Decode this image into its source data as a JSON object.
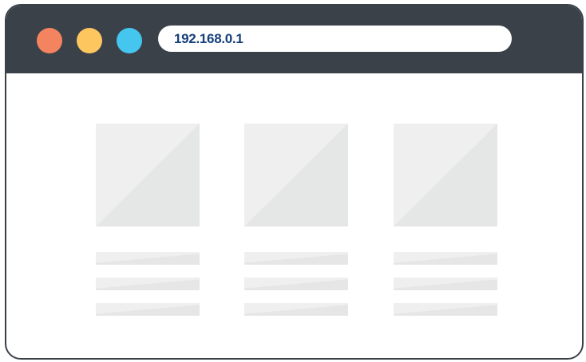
{
  "window": {
    "controls": {
      "close_color": "#f4845f",
      "minimize_color": "#fdc65f",
      "maximize_color": "#45c6ef"
    },
    "address_bar": {
      "value": "192.168.0.1",
      "text_color": "#16407a"
    },
    "titlebar_color": "#3a4149"
  },
  "content": {
    "cards": [
      {
        "icon": "image-placeholder-icon",
        "lines": 3
      },
      {
        "icon": "image-placeholder-icon",
        "lines": 3
      },
      {
        "icon": "image-placeholder-icon",
        "lines": 3
      }
    ],
    "placeholder_colors": [
      "#efefef",
      "#e5e6e6"
    ]
  }
}
